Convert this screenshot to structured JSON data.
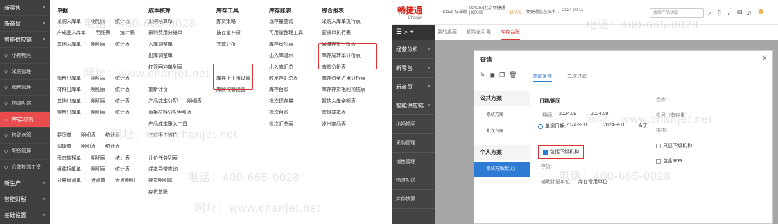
{
  "left": {
    "sidebar": [
      {
        "label": "新零售",
        "chev": "∨",
        "kind": "main"
      },
      {
        "label": "新商贸",
        "chev": "∨",
        "kind": "main"
      },
      {
        "label": "智能供应链",
        "chev": "∨",
        "kind": "main"
      },
      {
        "label": "小畅畅问",
        "kind": "sub"
      },
      {
        "label": "采购管理",
        "kind": "sub"
      },
      {
        "label": "销售管理",
        "kind": "sub"
      },
      {
        "label": "物流配送",
        "kind": "sub"
      },
      {
        "label": "库存核算",
        "kind": "active"
      },
      {
        "label": "移动仓管",
        "kind": "sub"
      },
      {
        "label": "配货管理",
        "kind": "sub"
      },
      {
        "label": "仓储物流工资",
        "kind": "sub"
      },
      {
        "label": "新生产",
        "chev": "∨",
        "kind": "main"
      },
      {
        "label": "智能财税",
        "chev": "∨",
        "kind": "main"
      },
      {
        "label": "基础设置",
        "chev": "∨",
        "kind": "main"
      }
    ],
    "columns": [
      {
        "header": "单据",
        "rows": [
          [
            "采购入库单",
            "明细表",
            "统计表"
          ],
          [
            "产成品入库单",
            "明细表",
            "统计表"
          ],
          [
            "其他入库单",
            "明细表",
            "统计表"
          ],
          [
            ""
          ],
          [
            ""
          ],
          [
            "销售出库单",
            "明细表",
            "统计表"
          ],
          [
            "材料出库单",
            "明细表",
            "统计表"
          ],
          [
            "其他出库单",
            "明细表",
            "统计表"
          ],
          [
            "零售出库单",
            "明细表",
            "统计表"
          ],
          [
            ""
          ],
          [
            "要货单",
            "明细表",
            "统计表"
          ],
          [
            "调拨单",
            "明细表",
            "统计表"
          ],
          [
            "形态转换单",
            "明细表",
            "统计表"
          ],
          [
            "组装拆卸单",
            "明细表",
            "统计表"
          ],
          [
            "分量盘点单",
            "盘点单",
            "盘点明细"
          ]
        ]
      },
      {
        "header": "成本核算",
        "rows": [
          [
            "采购结算单"
          ],
          [
            "采购费用分摊单"
          ],
          [
            "入库调整单"
          ],
          [
            "出库调整单"
          ],
          [
            "杠篮回冲单列表"
          ],
          [
            ""
          ],
          [
            "重新计价"
          ],
          [
            "产品成本分配",
            "明细表"
          ],
          [
            "直接材料分配明细表"
          ],
          [
            "产品成本录入工具"
          ],
          [
            "产成手工维护"
          ],
          [
            ""
          ],
          [
            "计价任务列表"
          ],
          [
            "成本异常查询"
          ],
          [
            "存货明细账"
          ],
          [
            "存货总账"
          ]
        ]
      },
      {
        "header": "库存工具",
        "rows": [
          [
            "拣货策略"
          ],
          [
            "按存量补货"
          ],
          [
            "齐套分析"
          ],
          [
            ""
          ],
          [
            ""
          ],
          [
            "库存上下限设置"
          ],
          [
            "库龄预警设置"
          ]
        ]
      },
      {
        "header": "库存账表",
        "rows": [
          [
            "现存量查询"
          ],
          [
            "可用量整理工具"
          ],
          [
            "库存状况表"
          ],
          [
            "出入库流水"
          ],
          [
            "出入库汇总"
          ],
          [
            "收发存汇总表"
          ],
          [
            "库存台账"
          ],
          [
            "批次现存量"
          ],
          [
            "批次台账"
          ],
          [
            "批次汇总表"
          ]
        ]
      },
      {
        "header": "综合报表",
        "rows": [
          [
            "采购入库单执行表"
          ],
          [
            "要货单执行表"
          ],
          [
            "呆滞存货分析表"
          ],
          [
            "库存周转率分析表"
          ],
          [
            "库龄分析表"
          ],
          [
            "库存资金占用分析表"
          ],
          [
            "库存存货毛利预估表"
          ],
          [
            "暂估入库余额表"
          ],
          [
            "虚拟成本表"
          ],
          [
            "发出商品表"
          ]
        ]
      }
    ],
    "watermark": {
      "phone": "电话：400-665-0028",
      "site": "网址：www.chanjet.net"
    }
  },
  "right": {
    "topbar": {
      "brand": "畅捷通",
      "brand_sub": "Chanjet",
      "cloud": "iCloud 标准版",
      "company": "004287|北京畅捷通",
      "account": "[0]0000",
      "license": "已认证",
      "user": "畅捷通信息技术...",
      "date": "2024-09-11",
      "search_placeholder": "搜索产品功能"
    },
    "sidebar": [
      {
        "label": "经营分析",
        "chev": "∨",
        "kind": "main"
      },
      {
        "label": "新零售",
        "chev": "∨",
        "kind": "main"
      },
      {
        "label": "新商贸",
        "chev": "∨",
        "kind": "main"
      },
      {
        "label": "智能供应链",
        "chev": "∨",
        "kind": "main"
      },
      {
        "label": "小畅畅问",
        "kind": "sub"
      },
      {
        "label": "采购管理",
        "kind": "sub"
      },
      {
        "label": "销售管理",
        "kind": "sub"
      },
      {
        "label": "物流配送",
        "kind": "sub"
      },
      {
        "label": "库存核算",
        "kind": "sub"
      }
    ],
    "tabs": [
      "我的桌面",
      "初始化引导",
      "库存台账"
    ],
    "dialog": {
      "title": "查询",
      "close": "X",
      "tab_conditions": "查询条件",
      "tab_secondary": "二次过滤",
      "public_plan": "公共方案",
      "public_items": [
        "系统方案",
        "批次台账"
      ],
      "personal_plan": "个人方案",
      "personal_items": [
        "系统方案(默认)"
      ],
      "date_period": "日期/期间",
      "period_label": "期间:",
      "period_from": "2024.09",
      "period_to": "2024.09",
      "single_date_label": "单据日期:",
      "date_from": "2024-9-11",
      "date_to": "2024-9-11",
      "today": "今天",
      "include_sub": "包括下级机构",
      "warehouse_label": "存货:",
      "warehouse_value": "库存常用单位",
      "warehouse_row_label": "辅助计量单位:",
      "store_label": "仓库:",
      "batch_label": "批号（有存量）:",
      "org_label": "机构:",
      "only_org": "只显下级机构",
      "include_unaudited": "包含未审"
    }
  }
}
